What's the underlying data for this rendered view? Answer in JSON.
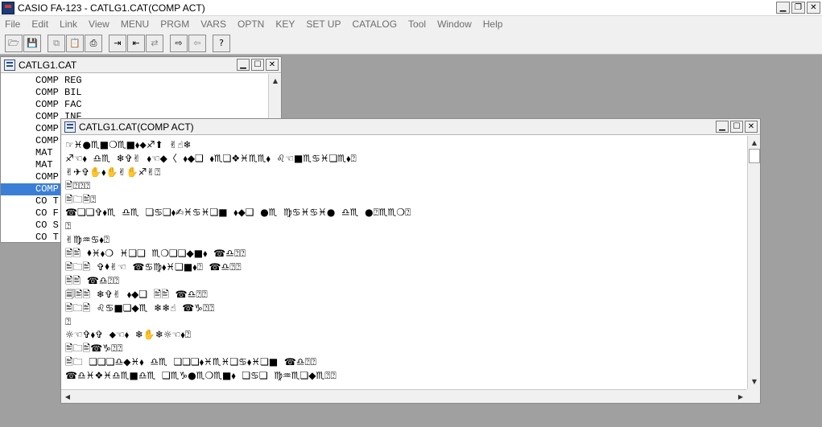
{
  "app": {
    "title": "CASIO FA-123 - CATLG1.CAT(COMP ACT)"
  },
  "menu": [
    "File",
    "Edit",
    "Link",
    "View",
    "MENU",
    "PRGM",
    "VARS",
    "OPTN",
    "KEY",
    "SET UP",
    "CATALOG",
    "Tool",
    "Window",
    "Help"
  ],
  "toolbar": {
    "buttons": [
      {
        "name": "open-icon",
        "glyph": "🗁"
      },
      {
        "name": "save-icon",
        "glyph": "💾"
      },
      {
        "name": "copy-icon",
        "glyph": "⧉"
      },
      {
        "name": "paste-icon",
        "glyph": "📋"
      },
      {
        "name": "print-icon",
        "glyph": "⎙"
      },
      {
        "name": "send-icon",
        "glyph": "⇥"
      },
      {
        "name": "receive-icon",
        "glyph": "⇤"
      },
      {
        "name": "transfer-icon",
        "glyph": "⇄"
      },
      {
        "name": "export-icon",
        "glyph": "⇨"
      },
      {
        "name": "import-icon",
        "glyph": "⇦"
      },
      {
        "name": "help-icon",
        "glyph": "?"
      }
    ]
  },
  "catalog_window": {
    "title": "CATLG1.CAT",
    "items": [
      "COMP REG",
      "COMP BIL",
      "COMP FAC",
      "COMP INF",
      "COMP",
      "COMP",
      "MAT",
      "MAT",
      "COMP",
      "COMP",
      "CO T",
      "CO F",
      "CO S",
      "CO T"
    ],
    "selected_index": 9
  },
  "act_window": {
    "title": "CATLG1.CAT(COMP ACT)",
    "lines": [
      "☞♓●♏■❍♏■⬧⬥♐⬆  ✌☝❄",
      "♐☜⬧  ♎♏  ❄✞✌  ⬧☜◆〈  ⬧◆❑  ⬧♏❏❖♓♏♏⬧  ♌☜■♏♋♓❏♏⬧⍰",
      "✌✈✞✋⬧✋✌✋♐✌⍰",
      "🖹⍰⍰⍰",
      "🖹🗀🖹⍰",
      "☎❏❏✞⬧♏  ♎♏  ❏♋❏⬧✍♓♋♓❏■  ⬧◆❑  ●♏  ♍♋♓♋♓●  ♎♏  ●⍰♏♏❍⍰",
      "⍰",
      "✌♍♒♋⬧⍰",
      "🖹🖹  ⬧♓⬧❍  ♓❏❏  ♏❍❏❏◆■⬧  ☎♎⍰⍰",
      "🖹🗀🖹  ✞⬧✌☜  ☎♋♍⬧♓❏■⬧⍰  ☎♎⍰⍰",
      "🖹🖹  ☎♎⍰⍰",
      "🗐🖹🖹  ❄✞✌  ⬧◆❑  🖹🖹  ☎♎⍰⍰",
      "🖹🗀🖹  ♌♋■❏◆♏  ❄❄☝  ☎♑⍰⍰",
      "⍰",
      "☼☜✞⬧✞  ⬥☜⬧  ❄✋❄☼☜⬧⍰",
      "🖹🗀🖹☎♑⍰⍰",
      "🖹🗀  ❏❏❏♎◆♓⬧  ♎♏  ❏❏❏⬧♓♏♓❏♋⬧♓❏■  ☎♎⍰⍰",
      "☎♎♓❖♓♎♏■♎♏  ❏♏♑●♏❍♏■⬧  ❏♋❏  ♍♒♏❏◆♏⍰⍰"
    ]
  }
}
